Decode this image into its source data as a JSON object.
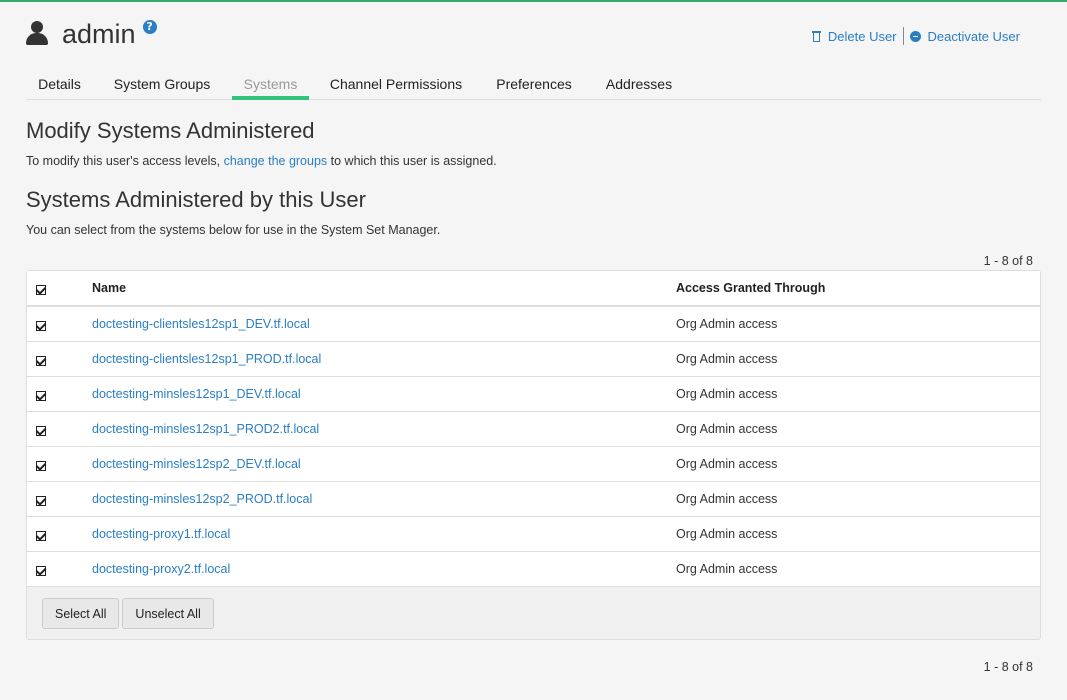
{
  "header": {
    "title": "admin",
    "help_glyph": "?",
    "delete_label": "Delete User",
    "deactivate_label": "Deactivate User"
  },
  "tabs": [
    {
      "label": "Details",
      "active": false
    },
    {
      "label": "System Groups",
      "active": false
    },
    {
      "label": "Systems",
      "active": true
    },
    {
      "label": "Channel Permissions",
      "active": false
    },
    {
      "label": "Preferences",
      "active": false
    },
    {
      "label": "Addresses",
      "active": false
    }
  ],
  "modify": {
    "heading": "Modify Systems Administered",
    "text_before": "To modify this user's access levels, ",
    "link": "change the groups",
    "text_after": " to which this user is assigned."
  },
  "administered": {
    "heading": "Systems Administered by this User",
    "description": "You can select from the systems below for use in the System Set Manager."
  },
  "pager": "1 - 8 of 8",
  "table": {
    "columns": [
      "Name",
      "Access Granted Through"
    ],
    "rows": [
      {
        "name": "doctesting-clientsles12sp1_DEV.tf.local",
        "access": "Org Admin access"
      },
      {
        "name": "doctesting-clientsles12sp1_PROD.tf.local",
        "access": "Org Admin access"
      },
      {
        "name": "doctesting-minsles12sp1_DEV.tf.local",
        "access": "Org Admin access"
      },
      {
        "name": "doctesting-minsles12sp1_PROD2.tf.local",
        "access": "Org Admin access"
      },
      {
        "name": "doctesting-minsles12sp2_DEV.tf.local",
        "access": "Org Admin access"
      },
      {
        "name": "doctesting-minsles12sp2_PROD.tf.local",
        "access": "Org Admin access"
      },
      {
        "name": "doctesting-proxy1.tf.local",
        "access": "Org Admin access"
      },
      {
        "name": "doctesting-proxy2.tf.local",
        "access": "Org Admin access"
      }
    ]
  },
  "buttons": {
    "select_all": "Select All",
    "unselect_all": "Unselect All"
  },
  "colors": {
    "accent": "#34c37a",
    "link": "#2a7ec4",
    "top_bar": "#3aa66f"
  },
  "icons": {
    "user": "user-icon",
    "help": "help-icon",
    "delete": "trash-icon",
    "deactivate": "minus-circle-icon",
    "checkbox": "checkbox-checked-icon"
  }
}
